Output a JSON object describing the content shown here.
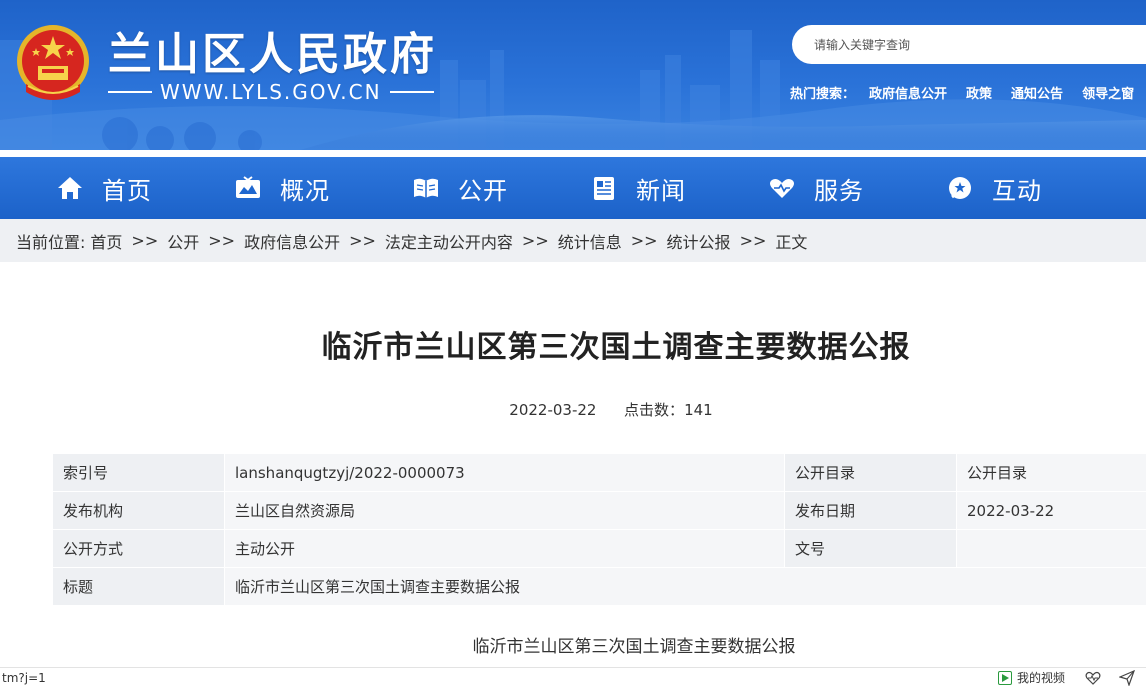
{
  "header": {
    "site_title": "兰山区人民政府",
    "site_url": "WWW.LYLS.GOV.CN",
    "search_placeholder": "请输入关键字查询",
    "hot_label": "热门搜索：",
    "hot_links": [
      "政府信息公开",
      "政策",
      "通知公告",
      "领导之窗"
    ]
  },
  "nav": {
    "items": [
      {
        "label": "首页",
        "icon": "home-icon"
      },
      {
        "label": "概况",
        "icon": "overview-icon"
      },
      {
        "label": "公开",
        "icon": "book-icon"
      },
      {
        "label": "新闻",
        "icon": "news-icon"
      },
      {
        "label": "服务",
        "icon": "service-heart-icon"
      },
      {
        "label": "互动",
        "icon": "chat-icon"
      }
    ]
  },
  "breadcrumb": {
    "prefix": "当前位置:",
    "items": [
      "首页",
      "公开",
      "政府信息公开",
      "法定主动公开内容",
      "统计信息",
      "统计公报",
      "正文"
    ],
    "separator": ">>"
  },
  "article": {
    "title": "临沂市兰山区第三次国土调查主要数据公报",
    "date": "2022-03-22",
    "views_label": "点击数：",
    "views": "141",
    "sub_title": "临沂市兰山区第三次国土调查主要数据公报"
  },
  "info_table": {
    "rows": [
      [
        "索引号",
        "lanshanqugtzyj/2022-0000073",
        "公开目录",
        "公开目录"
      ],
      [
        "发布机构",
        "兰山区自然资源局",
        "发布日期",
        "2022-03-22"
      ],
      [
        "公开方式",
        "主动公开",
        "文号",
        ""
      ],
      [
        "标题",
        "临沂市兰山区第三次国土调查主要数据公报"
      ]
    ]
  },
  "status_bar": {
    "url_fragment": "tm?j=1",
    "video_label": "我的视频"
  },
  "colors": {
    "banner_blue": "#1f63c9",
    "nav_blue": "#1c62c9",
    "crumb_bg": "#eef0f3"
  }
}
